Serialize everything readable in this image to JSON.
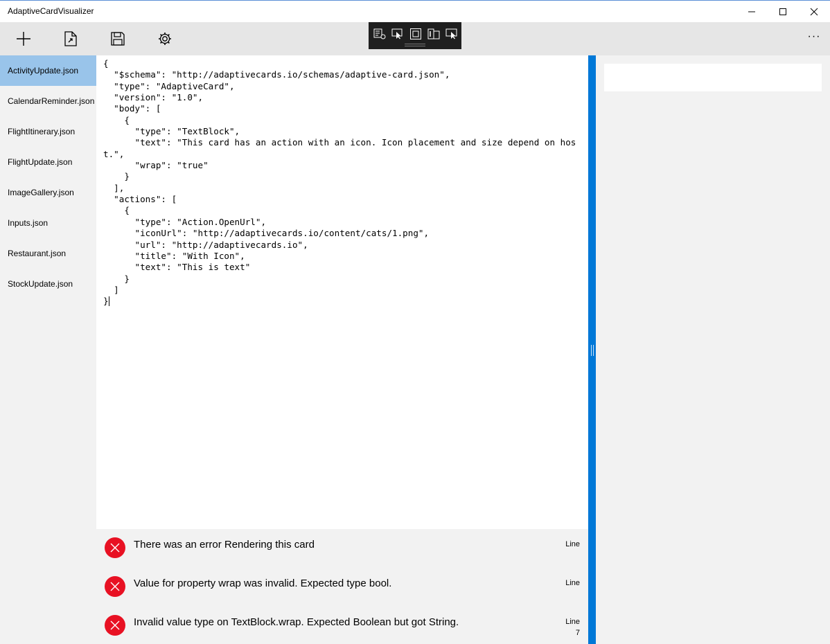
{
  "window": {
    "title": "AdaptiveCardVisualizer",
    "minimize_icon": "minimize-icon",
    "maximize_icon": "maximize-icon",
    "close_icon": "close-icon"
  },
  "toolbar": {
    "buttons": [
      {
        "name": "new-button",
        "icon": "plus-icon"
      },
      {
        "name": "open-button",
        "icon": "open-file-icon"
      },
      {
        "name": "save-button",
        "icon": "save-icon"
      },
      {
        "name": "settings-button",
        "icon": "gear-icon"
      }
    ],
    "more_label": "···"
  },
  "dev_toolbar": {
    "buttons": [
      "live-visual-tree-icon",
      "select-element-icon",
      "display-layout-adorners-icon",
      "track-focus-icon",
      "element-selection-icon"
    ]
  },
  "sidebar": {
    "selected_index": 0,
    "items": [
      {
        "label": "ActivityUpdate.json"
      },
      {
        "label": "CalendarReminder.json"
      },
      {
        "label": "FlightItinerary.json"
      },
      {
        "label": "FlightUpdate.json"
      },
      {
        "label": "ImageGallery.json"
      },
      {
        "label": "Inputs.json"
      },
      {
        "label": "Restaurant.json"
      },
      {
        "label": "StockUpdate.json"
      }
    ]
  },
  "editor": {
    "content": "{\n  \"$schema\": \"http://adaptivecards.io/schemas/adaptive-card.json\",\n  \"type\": \"AdaptiveCard\",\n  \"version\": \"1.0\",\n  \"body\": [\n    {\n      \"type\": \"TextBlock\",\n      \"text\": \"This card has an action with an icon. Icon placement and size depend on host.\",\n      \"wrap\": \"true\"\n    }\n  ],\n  \"actions\": [\n    {\n      \"type\": \"Action.OpenUrl\",\n      \"iconUrl\": \"http://adaptivecards.io/content/cats/1.png\",\n      \"url\": \"http://adaptivecards.io\",\n      \"title\": \"With Icon\",\n      \"text\": \"This is text\"\n    }\n  ]\n}"
  },
  "errors": [
    {
      "message": "There was an error Rendering this card",
      "line_label": "Line",
      "line_number": ""
    },
    {
      "message": "Value for property wrap was invalid. Expected type bool.",
      "line_label": "Line",
      "line_number": ""
    },
    {
      "message": "Invalid value type on TextBlock.wrap. Expected Boolean but got String.",
      "line_label": "Line",
      "line_number": "7"
    }
  ],
  "colors": {
    "accent": "#0078d7",
    "selected_item": "#99c4ea",
    "error": "#e81123"
  }
}
